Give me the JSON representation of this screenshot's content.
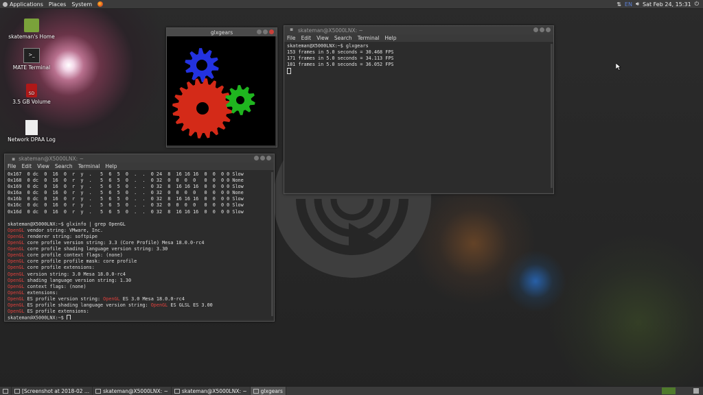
{
  "top_panel": {
    "menus": [
      "Applications",
      "Places",
      "System"
    ],
    "clock": "Sat Feb 24, 15:31",
    "keyboard_layout": "EN"
  },
  "desktop_icons": [
    {
      "label": "skateman's Home",
      "icon": "home-folder-icon"
    },
    {
      "label": "MATE Terminal",
      "icon": "terminal-icon"
    },
    {
      "label": "3.5 GB Volume",
      "icon": "sd-card-icon"
    },
    {
      "label": "Network DPAA Log",
      "icon": "text-file-icon"
    }
  ],
  "glxgears": {
    "title": "glxgears",
    "colors": {
      "red": "#d42a18",
      "green": "#1fb51f",
      "blue": "#2332e0"
    }
  },
  "terminal_top": {
    "title": "skateman@X5000LNX: ~",
    "menu": [
      "File",
      "Edit",
      "View",
      "Search",
      "Terminal",
      "Help"
    ],
    "lines": [
      "skateman@X5000LNX:~$ glxgears",
      "153 frames in 5.0 seconds = 30.468 FPS",
      "171 frames in 5.0 seconds = 34.113 FPS",
      "181 frames in 5.0 seconds = 36.052 FPS"
    ]
  },
  "terminal_bottom": {
    "title": "skateman@X5000LNX: ~",
    "menu": [
      "File",
      "Edit",
      "View",
      "Search",
      "Terminal",
      "Help"
    ],
    "visual_table": [
      "0x167  0 dc  0  16  0  r  y  .   5  6  5  0  .  .  0 24  8  16 16 16  0  0  0 0 Slow",
      "0x168  0 dc  0  16  0  r  y  .   5  6  5  0  .  .  0 32  0  0  0  0   0  0  0 0 None",
      "0x169  0 dc  0  16  0  r  y  .   5  6  5  0  .  .  0 32  8  16 16 16  0  0  0 0 Slow",
      "0x16a  0 dc  0  16  0  r  y  .   5  6  5  0  .  .  0 32  0  0  0  0   0  0  0 0 None",
      "0x16b  0 dc  0  16  0  r  y  .   5  6  5  0  .  .  0 32  8  16 16 16  0  0  0 0 Slow",
      "0x16c  0 dc  0  16  0  r  y  .   5  6  5  0  .  .  0 32  0  0  0  0   0  0  0 0 Slow",
      "0x16d  0 dc  0  16  0  r  y  .   5  6  5  0  .  .  0 32  8  16 16 16  0  0  0 0 Slow"
    ],
    "command": "skateman@X5000LNX:~$ glxinfo | grep OpenGL",
    "gl_lines": [
      {
        "pre": "OpenGL",
        "mid": "",
        "post": " vendor string: VMware, Inc."
      },
      {
        "pre": "OpenGL",
        "mid": "",
        "post": " renderer string: softpipe"
      },
      {
        "pre": "OpenGL",
        "mid": "",
        "post": " core profile version string: 3.3 (Core Profile) Mesa 18.0.0-rc4"
      },
      {
        "pre": "OpenGL",
        "mid": "",
        "post": " core profile shading language version string: 3.30"
      },
      {
        "pre": "OpenGL",
        "mid": "",
        "post": " core profile context flags: (none)"
      },
      {
        "pre": "OpenGL",
        "mid": "",
        "post": " core profile profile mask: core profile"
      },
      {
        "pre": "OpenGL",
        "mid": "",
        "post": " core profile extensions:"
      },
      {
        "pre": "OpenGL",
        "mid": "",
        "post": " version string: 3.0 Mesa 18.0.0-rc4"
      },
      {
        "pre": "OpenGL",
        "mid": "",
        "post": " shading language version string: 1.30"
      },
      {
        "pre": "OpenGL",
        "mid": "",
        "post": " context flags: (none)"
      },
      {
        "pre": "OpenGL",
        "mid": "",
        "post": " extensions:"
      },
      {
        "pre": "OpenGL",
        "mid": " ES profile version string: ",
        "red2": "OpenGL",
        "post": " ES 3.0 Mesa 18.0.0-rc4"
      },
      {
        "pre": "OpenGL",
        "mid": " ES profile shading language version string: ",
        "red2": "OpenGL",
        "post": " ES GLSL ES 3.00"
      },
      {
        "pre": "OpenGL",
        "mid": "",
        "post": " ES profile extensions:"
      }
    ],
    "prompt": "skateman@X5000LNX:~$ "
  },
  "taskbar": {
    "tasks": [
      {
        "label": "[Screenshot at 2018-02 ...",
        "active": false
      },
      {
        "label": "skateman@X5000LNX: ~",
        "active": false
      },
      {
        "label": "skateman@X5000LNX: ~",
        "active": false
      },
      {
        "label": "glxgears",
        "active": true
      }
    ]
  }
}
